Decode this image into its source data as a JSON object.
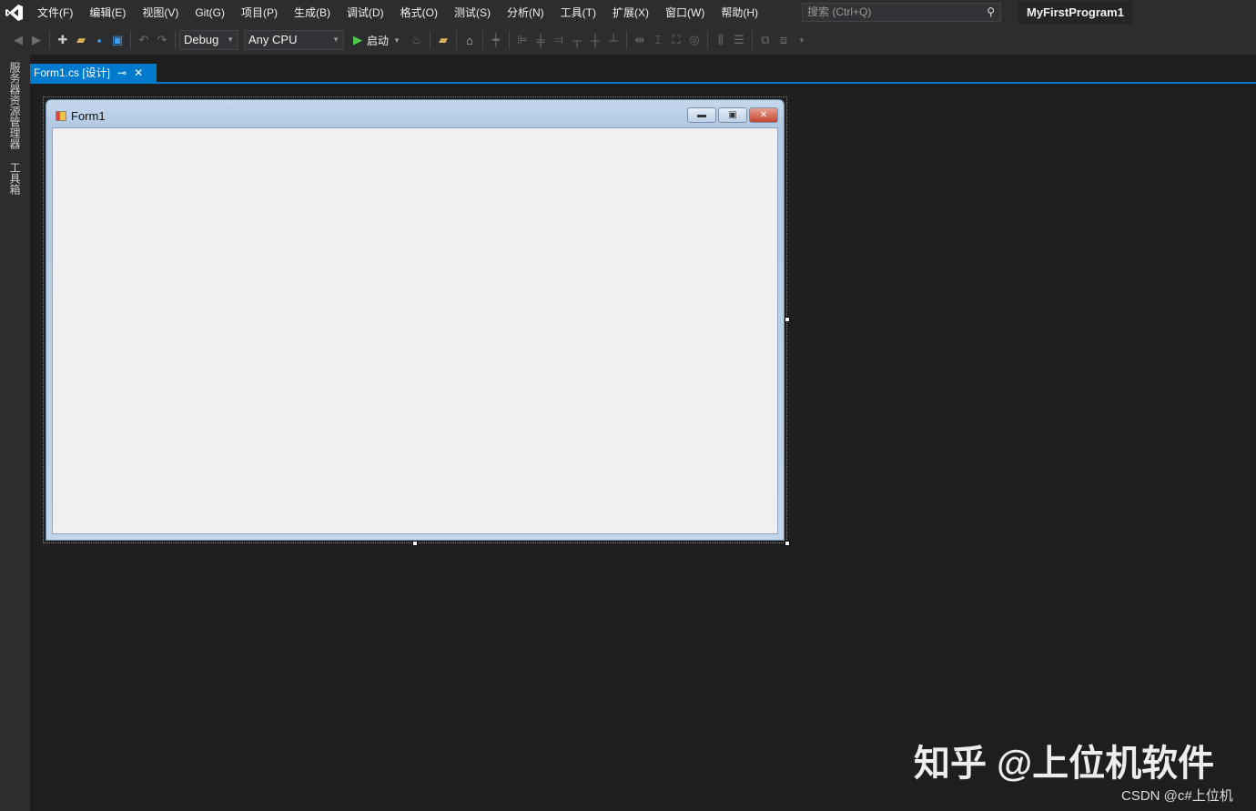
{
  "menu": [
    "文件(F)",
    "编辑(E)",
    "视图(V)",
    "Git(G)",
    "项目(P)",
    "生成(B)",
    "调试(D)",
    "格式(O)",
    "测试(S)",
    "分析(N)",
    "工具(T)",
    "扩展(X)",
    "窗口(W)",
    "帮助(H)"
  ],
  "search": {
    "placeholder": "搜索 (Ctrl+Q)"
  },
  "project_name": "MyFirstProgram1",
  "toolbar": {
    "config": "Debug",
    "platform": "Any CPU",
    "start_label": "启动"
  },
  "sidebar": {
    "server_explorer": "服务器资源管理器",
    "toolbox": "工具箱"
  },
  "tab": {
    "label": "Form1.cs [设计]",
    "pin": "⊸",
    "close": "✕"
  },
  "form": {
    "title": "Form1"
  },
  "watermark": {
    "zhihu": "知乎 @上位机软件",
    "csdn": "CSDN @c#上位机"
  },
  "colors": {
    "accent": "#007acc",
    "bg": "#1e1e1e",
    "chrome": "#2d2d30"
  }
}
